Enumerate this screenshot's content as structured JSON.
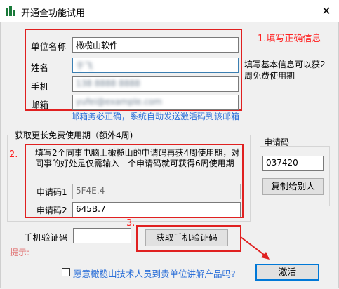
{
  "window": {
    "title": "开通全功能试用"
  },
  "basic_info": {
    "unit_label": "单位名称",
    "unit_value": "橄榄山软件",
    "name_label": "姓名",
    "name_value": "于飞",
    "phone_label": "手机",
    "phone_value": "138 8888 8888",
    "email_label": "邮箱",
    "email_value": "yufei@example.com",
    "side_note": "填写基本信息可以获2周免费使用期",
    "email_hint": "邮箱务必正确，系统自动发送激活码到该邮箱",
    "annotation": "1.填写正确信息"
  },
  "extend": {
    "group_title": "获取更长免费使用期（额外4周)",
    "annotation": "2.",
    "description": "填写2个同事电脑上橄榄山的申请码再获4周使用期，对同事的好处是仅需输入一个申请码就可获得6周使用期",
    "code1_label": "申请码1",
    "code1_value": "5F4E.4",
    "code2_label": "申请码2",
    "code2_value": "645B.7"
  },
  "request_code": {
    "title": "申请码",
    "value": "037420",
    "copy_button": "复制给别人"
  },
  "verify": {
    "label": "手机验证码",
    "value": "",
    "annotation": "3.",
    "get_code_button": "获取手机验证码",
    "hint_label": "提示:"
  },
  "footer": {
    "checkbox_label": "愿意橄榄山技术人员到贵单位讲解产品吗?",
    "activate_button": "激活"
  },
  "colors": {
    "annotation_red": "#ff2020",
    "hint_blue": "#2b6fd8",
    "focus_blue": "#0078d7"
  }
}
